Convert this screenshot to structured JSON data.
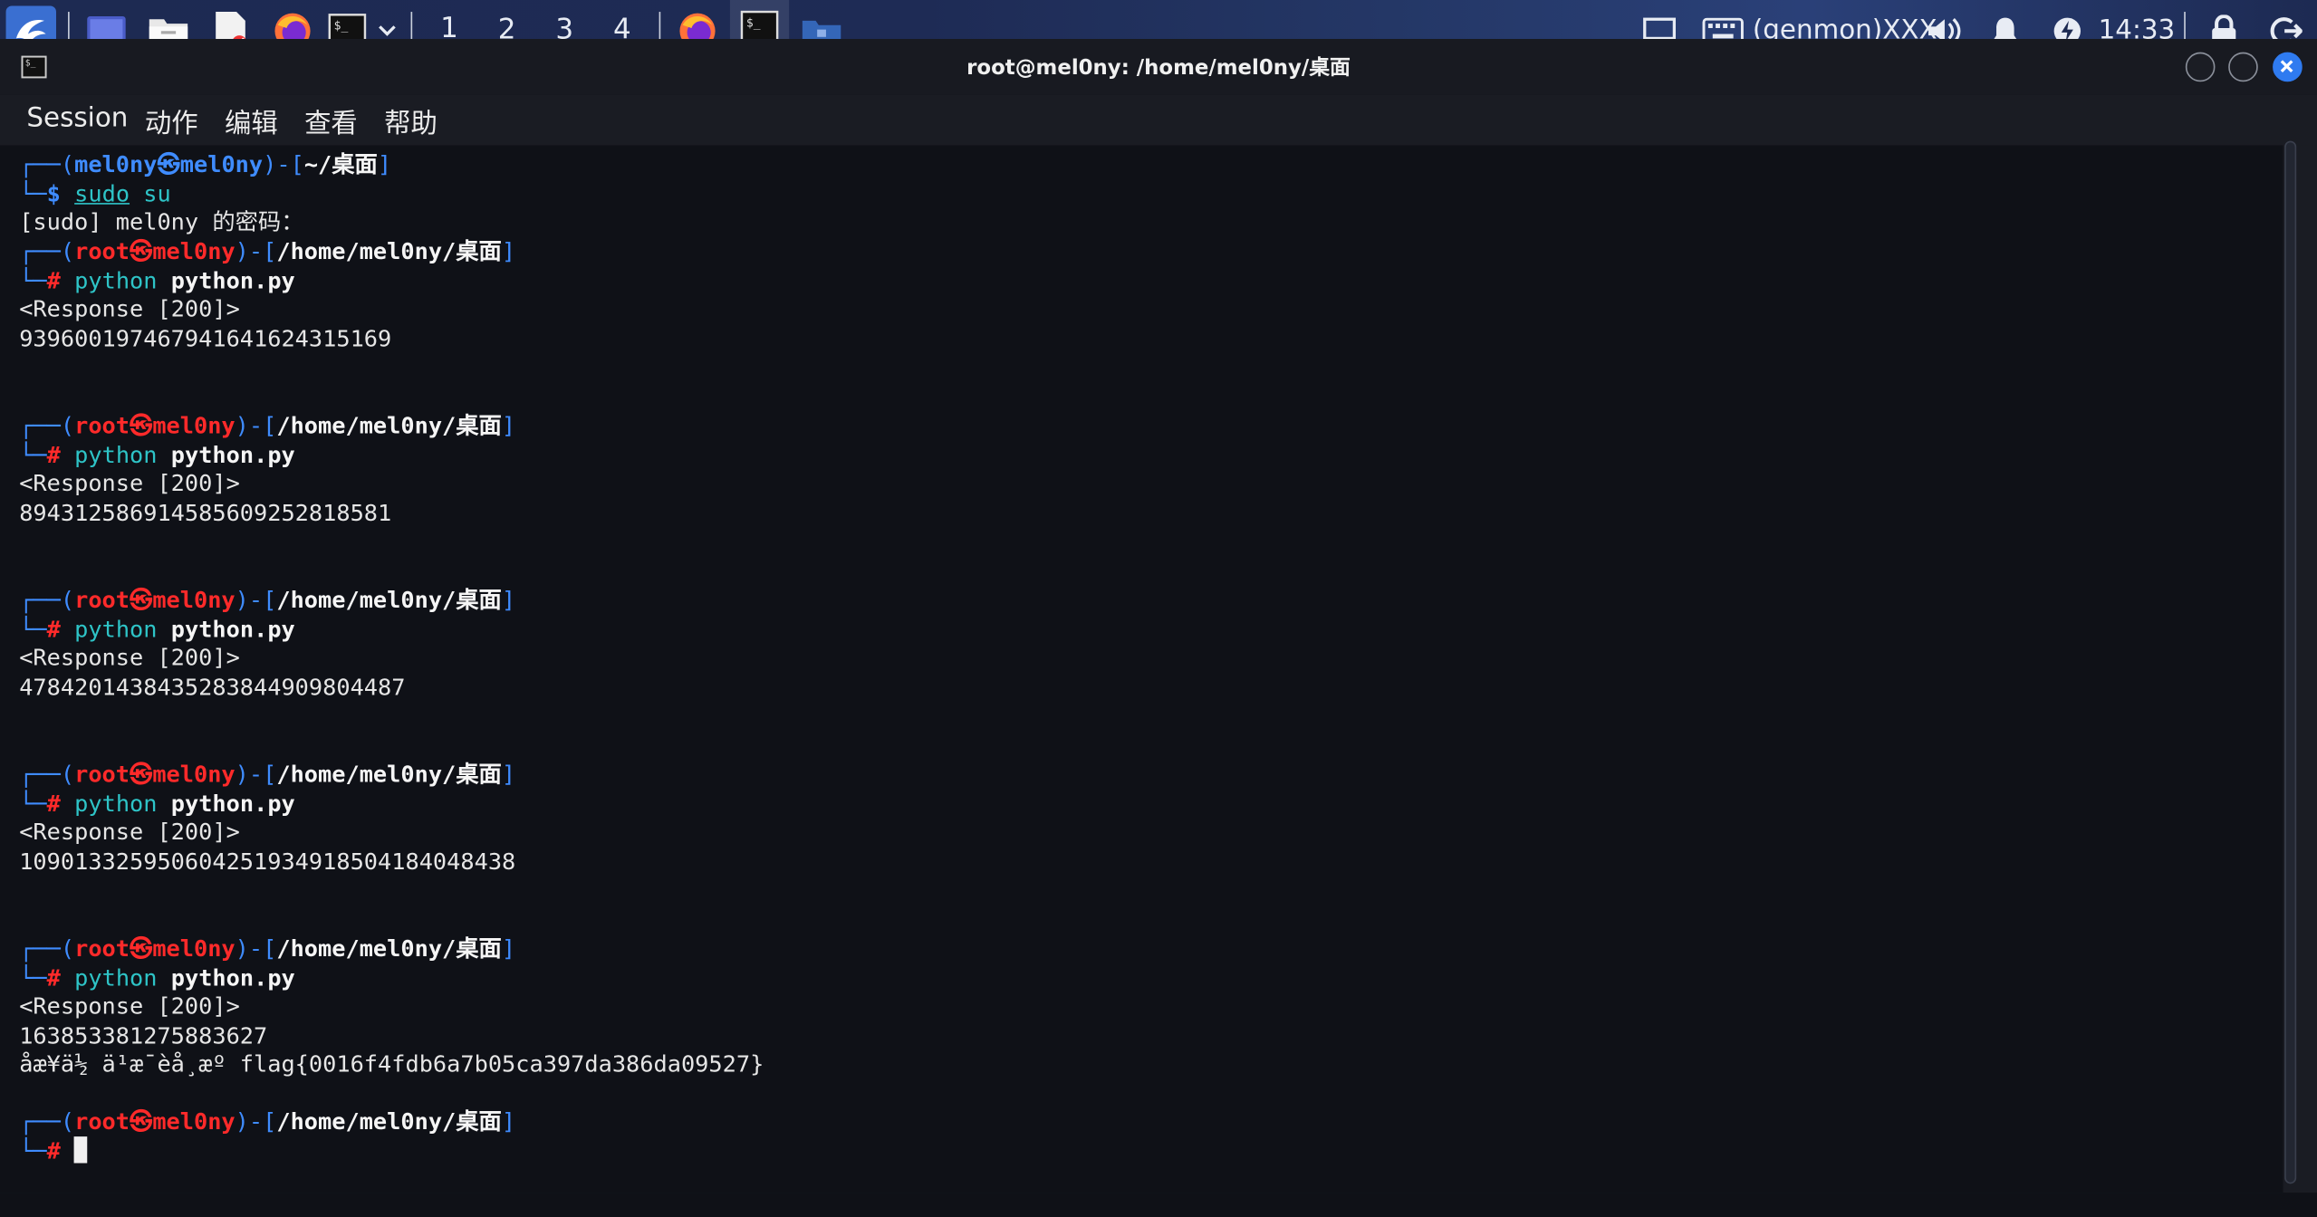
{
  "panel": {
    "workspaces": [
      "1",
      "2",
      "3",
      "4"
    ],
    "active_workspace": "1",
    "genmon": "(genmon)XXX",
    "clock": "14:33",
    "icons": [
      "kali-dragon-icon",
      "desktop-icon",
      "file-manager-icon",
      "text-editor-icon",
      "firefox-icon",
      "terminal-icon",
      "dropdown-chevron-icon",
      "firefox-task-icon",
      "terminal-task-icon",
      "folder-task-icon",
      "display-icon",
      "keyboard-icon",
      "volume-icon",
      "bell-icon",
      "power-icon",
      "lock-icon",
      "logout-icon"
    ]
  },
  "window": {
    "title": "root@mel0ny: /home/mel0ny/桌面",
    "menu": [
      "Session",
      "动作",
      "编辑",
      "查看",
      "帮助"
    ]
  },
  "terminal": {
    "prompt_user": "mel0ny",
    "prompt_host": "mel0ny",
    "prompt_root": "root",
    "prompt_dir_home": "~/桌面",
    "prompt_dir_root": "/home/mel0ny/桌面",
    "user_cmd_1": "sudo",
    "user_cmd_2": "su",
    "sudo_prompt": "[sudo] mel0ny 的密码：",
    "cmd_prog": "python",
    "cmd_file": "python.py",
    "response": "<Response [200]>",
    "outputs": [
      "9396001974679416416243151​69",
      "894312586914585609252818581",
      "478420143843528384490980448​7",
      "10901332595060425193491850418404843​8",
      "163853381275883627"
    ],
    "flag_line": "åæ¥ä½ ä¹æ¯èå¸æº flag{0016f4fdb6a7b05ca397da386da09527}",
    "prompt_glyph_hash": "#",
    "prompt_glyph_dollar": "$"
  }
}
